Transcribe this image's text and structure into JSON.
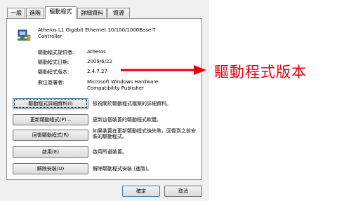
{
  "tabs": [
    {
      "label": "一般"
    },
    {
      "label": "進階"
    },
    {
      "label": "驅動程式",
      "active": true
    },
    {
      "label": "詳細資料"
    },
    {
      "label": "資源"
    }
  ],
  "device": {
    "name": "Atheros L1 Gigabit Ethernet 10/100/1000Base-T Controller",
    "icon": "network-adapter-icon"
  },
  "properties": [
    {
      "label": "驅動程式提供者:",
      "value": "Atheros"
    },
    {
      "label": "驅動程式日期:",
      "value": "2009/6/22"
    },
    {
      "label": "驅動程式版本:",
      "value": "2.4.7.27"
    },
    {
      "label": "數位簽署者:",
      "value": "Microsoft Windows Hardware Compatibility Publisher"
    }
  ],
  "actions": [
    {
      "button": "驅動程式詳細資料(I)",
      "description": "檢視關於驅動程式檔案的詳細資料。"
    },
    {
      "button": "更新驅動程式(P)...",
      "description": "更新這個裝置的驅動程式軟體。"
    },
    {
      "button": "回復驅動程式(R)",
      "description": "如果裝置在更新驅動程式後失敗，回復到之前安裝的驅動程式。"
    },
    {
      "button": "啟用(E)",
      "description": "啟用所選裝置。"
    },
    {
      "button": "解除安裝(U)",
      "description": "解除驅動程式安裝 (進階)。"
    }
  ],
  "footer": {
    "ok": "確定",
    "cancel": "取消"
  },
  "annotation": {
    "text": "驅動程式版本",
    "color": "#e60012"
  }
}
